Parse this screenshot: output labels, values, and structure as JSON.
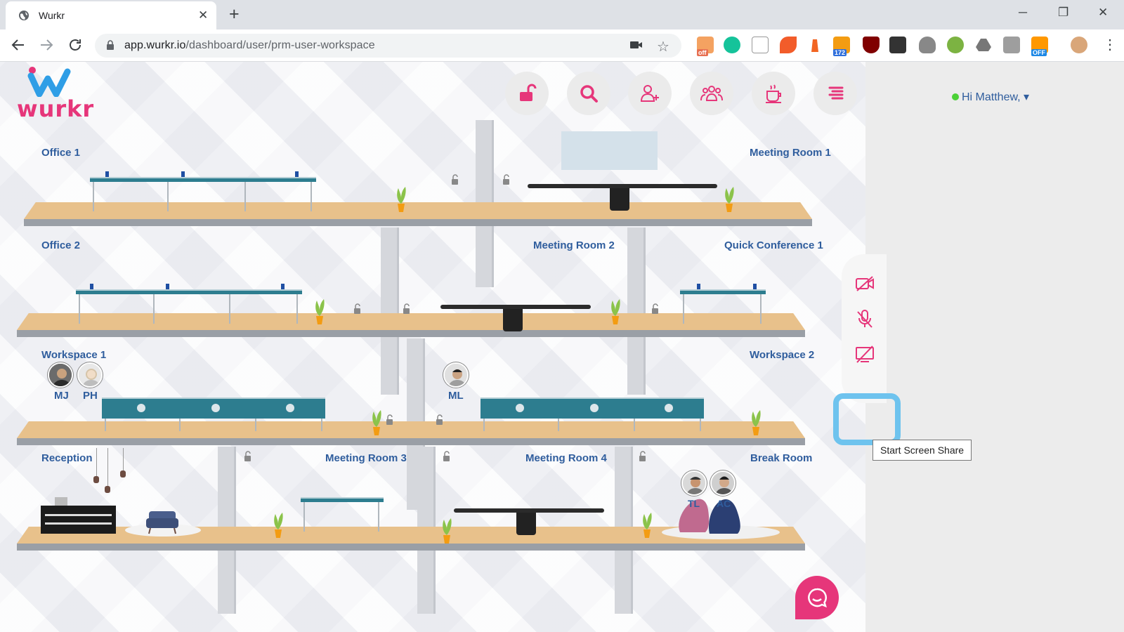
{
  "browser": {
    "tab_title": "Wurkr",
    "tab_close": "✕",
    "new_tab": "+",
    "url_host": "app.wurkr.io",
    "url_path": "/dashboard/user/prm-user-workspace",
    "window_minimize": "─",
    "window_restore": "❐",
    "window_close": "✕",
    "extension_badges": {
      "coupon": "off",
      "count": "172",
      "sale": "OFF"
    }
  },
  "app": {
    "logo_text": "wurkr",
    "greeting": "Hi Matthew,",
    "greeting_caret": "▾",
    "tooltip": "Start Screen Share",
    "colors": {
      "brand": "#e6367a",
      "label": "#2f5d9d",
      "highlight": "#6ec3ee",
      "online": "#4cd137"
    },
    "toolbar": [
      "lock-icon",
      "search-icon",
      "add-user-icon",
      "team-icon",
      "coffee-break-icon",
      "menu-icon"
    ],
    "side_controls": [
      "camera-off-icon",
      "mic-off-icon",
      "screen-share-off-icon"
    ]
  },
  "rooms": {
    "office_1": "Office 1",
    "meeting_room_1": "Meeting Room 1",
    "office_2": "Office 2",
    "meeting_room_2": "Meeting Room 2",
    "quick_conference_1": "Quick Conference 1",
    "workspace_1": "Workspace 1",
    "workspace_2": "Workspace 2",
    "reception": "Reception",
    "meeting_room_3": "Meeting Room 3",
    "meeting_room_4": "Meeting Room 4",
    "break_room": "Break Room"
  },
  "people": {
    "mj": "MJ",
    "ph": "PH",
    "ml": "ML",
    "tl": "TL",
    "ac": "AC"
  }
}
